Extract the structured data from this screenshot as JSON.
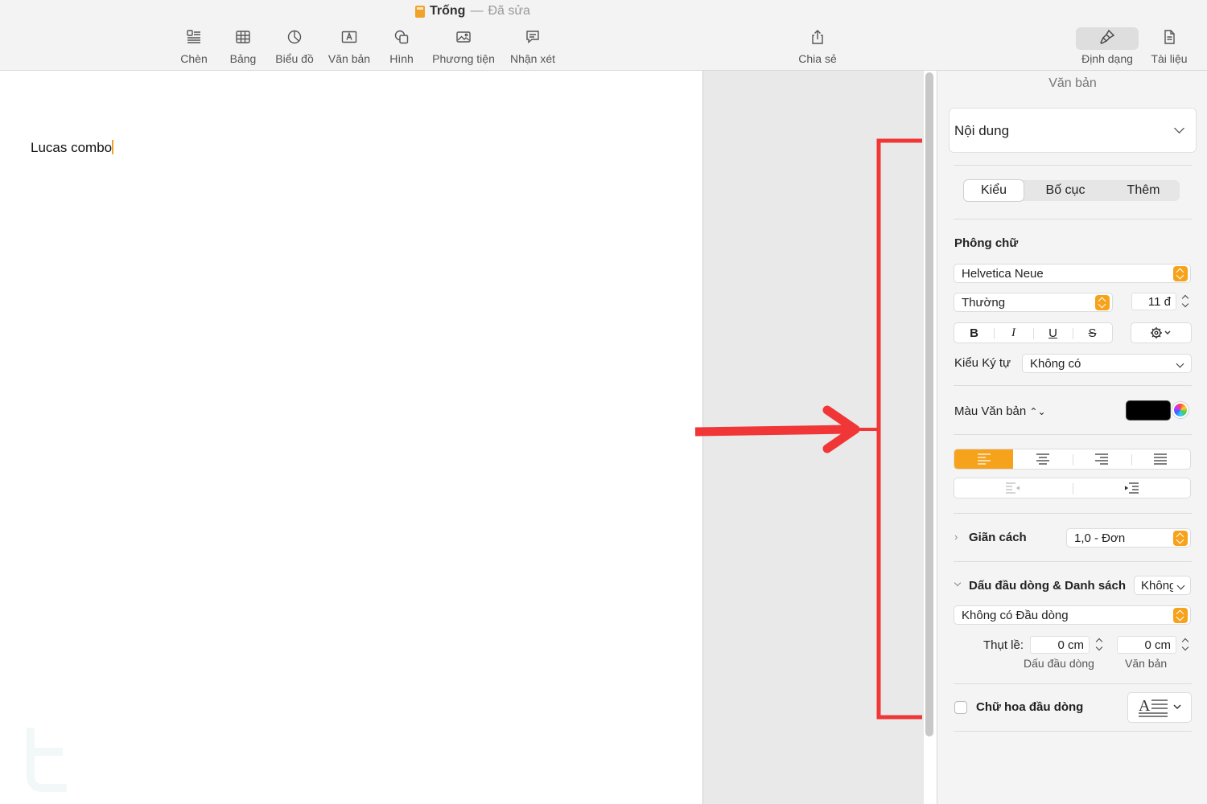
{
  "window": {
    "title": "Trống",
    "separator": "—",
    "status": "Đã sửa"
  },
  "toolbar": {
    "items": [
      {
        "label": "Chèn",
        "icon": "insert-icon"
      },
      {
        "label": "Bảng",
        "icon": "table-icon"
      },
      {
        "label": "Biểu đồ",
        "icon": "chart-icon"
      },
      {
        "label": "Văn bản",
        "icon": "textbox-icon"
      },
      {
        "label": "Hình",
        "icon": "shape-icon"
      },
      {
        "label": "Phương tiện",
        "icon": "media-icon"
      },
      {
        "label": "Nhận xét",
        "icon": "comment-icon"
      }
    ],
    "share": {
      "label": "Chia sẻ",
      "icon": "share-icon"
    },
    "format": {
      "label": "Định dạng",
      "icon": "paintbrush-icon"
    },
    "document": {
      "label": "Tài liệu",
      "icon": "document-icon"
    }
  },
  "document": {
    "text": "Lucas combo"
  },
  "sidebar": {
    "header": "Văn bản",
    "paragraph_style": "Nội dung",
    "tabs": [
      "Kiểu",
      "Bố cục",
      "Thêm"
    ],
    "selected_tab": "Kiểu",
    "font": {
      "section_label": "Phông chữ",
      "family": "Helvetica Neue",
      "typeface": "Thường",
      "size": "11 đ",
      "style_buttons": [
        "B",
        "I",
        "U",
        "S"
      ]
    },
    "char_style": {
      "label": "Kiểu Ký tự",
      "value": "Không có"
    },
    "text_color": {
      "label": "Màu Văn bản",
      "color": "#000000"
    },
    "spacing": {
      "label": "Giãn cách",
      "value": "1,0 - Đơn"
    },
    "bullets": {
      "label": "Dấu đầu dòng & Danh sách",
      "value": "Không",
      "list_style": "Không có Đầu dòng",
      "indent_label": "Thụt lề:",
      "bullet_indent": "0 cm",
      "text_indent": "0 cm",
      "bullet_caption": "Dấu đầu dòng",
      "text_caption": "Văn bản"
    },
    "drop_cap": {
      "label": "Chữ hoa đầu dòng"
    }
  },
  "colors": {
    "accent": "#f7a21b",
    "annotation": "#f03636"
  }
}
